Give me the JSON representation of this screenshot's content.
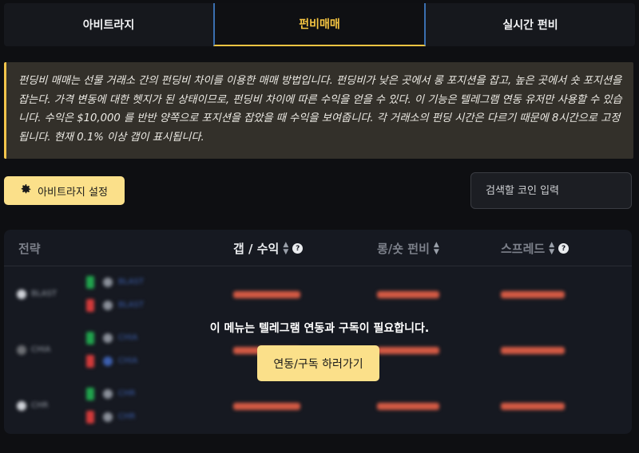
{
  "tabs": [
    {
      "label": "아비트라지"
    },
    {
      "label": "펀비매매",
      "active": true
    },
    {
      "label": "실시간 펀비"
    }
  ],
  "info": {
    "text": "펀딩비 매매는 선물 거래소 간의 펀딩비 차이를 이용한 매매 방법입니다. 펀딩비가 낮은 곳에서 롱 포지션을 잡고, 높은 곳에서 숏 포지션을 잡는다. 가격 변동에 대한 헷지가 된 상태이므로, 펀딩비 차이에 따른 수익을 얻을 수 있다. 이 기능은 텔레그램 연동 유저만 사용할 수 있습니다. 수익은 $10,000 를 반반 양쪽으로 포지션을 잡았을 때 수익을 보여줍니다. 각 거래소의 펀딩 시간은 다르기 때문에 8시간으로 고정됩니다. 현재 0.1% 이상 갭이 표시됩니다."
  },
  "toolbar": {
    "settings_label": "아비트라지 설정",
    "search_placeholder": "검색할 코인 입력"
  },
  "table": {
    "headers": {
      "strategy": "전략",
      "gap_profit": "갭 / 수익",
      "long_short_funding": "롱/숏 펀비",
      "spread": "스프레드"
    },
    "rows": [
      {
        "coin": "BLAST",
        "long_ex": "BLAST",
        "short_ex": "BLAST"
      },
      {
        "coin": "CHIA",
        "long_ex": "CHIA",
        "short_ex": "CHIA"
      },
      {
        "coin": "CHR",
        "long_ex": "CHR",
        "short_ex": "CHR"
      }
    ]
  },
  "overlay": {
    "message": "이 메뉴는 텔레그램 연동과 구독이 필요합니다.",
    "button_label": "연동/구독 하러가기"
  },
  "colors": {
    "accent": "#f5c542",
    "button_bg": "#fbe08a",
    "info_bg": "#33302a",
    "card_bg": "#161921",
    "bar_red": "#d35a44",
    "long_green": "#21a34d",
    "short_red": "#d23a3a"
  },
  "icons": {
    "settings": "gear-icon",
    "help": "question-circle-icon",
    "sort": "sort-icon"
  }
}
